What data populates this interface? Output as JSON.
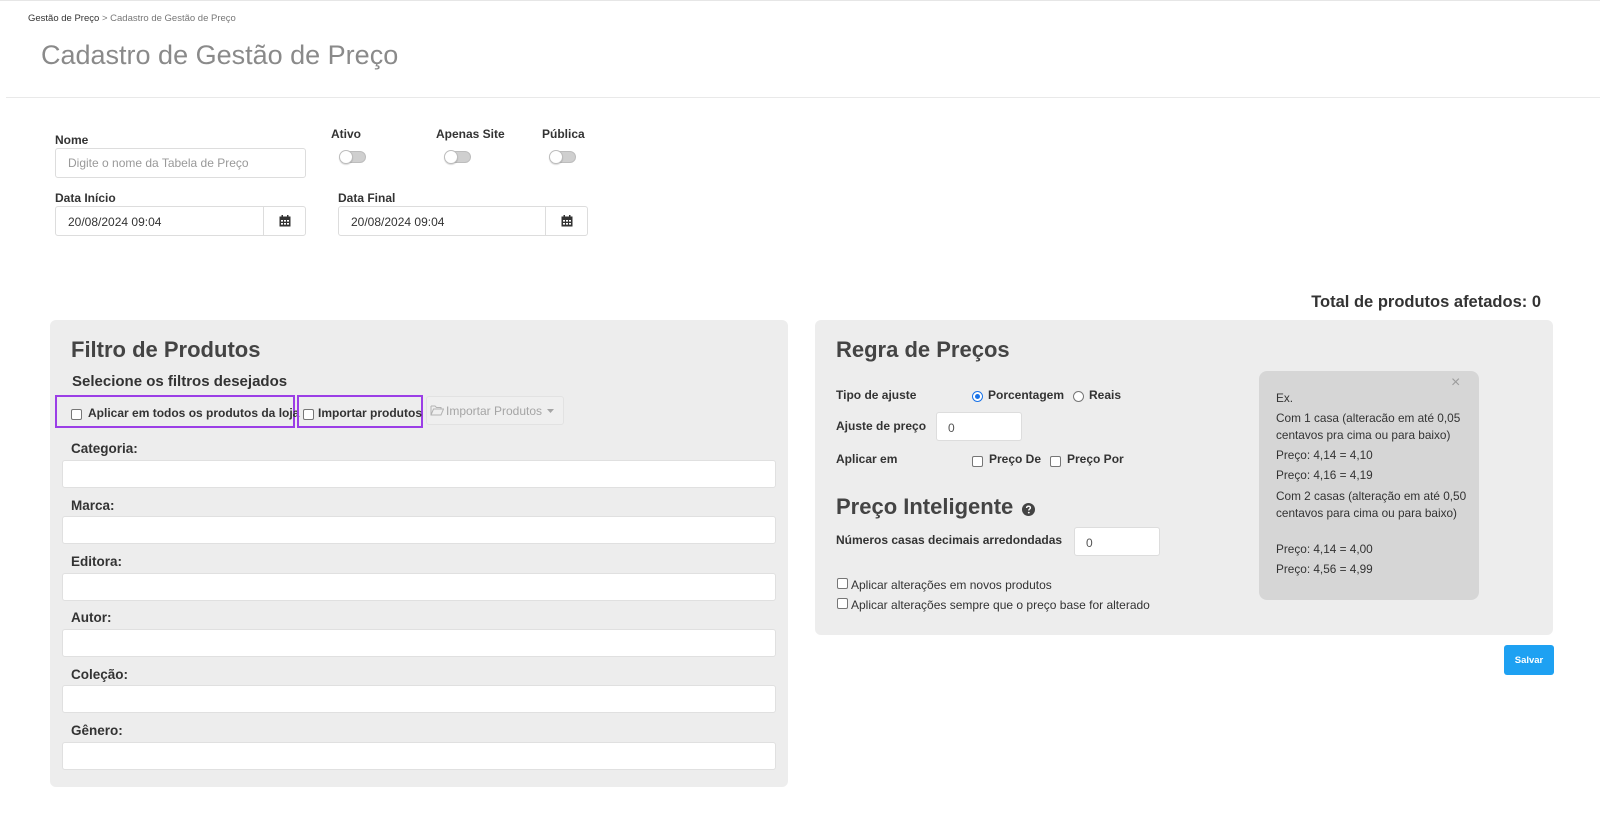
{
  "breadcrumb": {
    "parent": "Gestão de Preço",
    "separator": ">",
    "current": "Cadastro de Gestão de Preço"
  },
  "page_title": "Cadastro de Gestão de Preço",
  "form": {
    "nome_label": "Nome",
    "nome_placeholder": "Digite o nome da Tabela de Preço",
    "nome_value": "",
    "ativo_label": "Ativo",
    "apenas_site_label": "Apenas Site",
    "publica_label": "Pública",
    "toggles": {
      "ativo": false,
      "apenas_site": false,
      "publica": false
    },
    "data_inicio_label": "Data Início",
    "data_inicio_value": "20/08/2024 09:04",
    "data_final_label": "Data Final",
    "data_final_value": "20/08/2024 09:04"
  },
  "total_afetados": "Total de produtos afetados: 0",
  "filtro": {
    "title": "Filtro de Produtos",
    "subtitle": "Selecione os filtros desejados",
    "aplicar_todos_label": "Aplicar em todos os produtos da loja",
    "importar_label": "Importar produtos",
    "importar_button_label": "Importar Produtos",
    "fields": [
      {
        "label": "Categoria:",
        "value": ""
      },
      {
        "label": "Marca:",
        "value": ""
      },
      {
        "label": "Editora:",
        "value": ""
      },
      {
        "label": "Autor:",
        "value": ""
      },
      {
        "label": "Coleção:",
        "value": ""
      },
      {
        "label": "Gênero:",
        "value": ""
      }
    ]
  },
  "regra": {
    "title": "Regra de Preços",
    "tipo_label": "Tipo de ajuste",
    "tipo_options": [
      "Porcentagem",
      "Reais"
    ],
    "tipo_selected": "Porcentagem",
    "ajuste_label": "Ajuste de preço",
    "ajuste_value": "0",
    "aplicar_em_label": "Aplicar em",
    "aplicar_em_options": [
      "Preço De",
      "Preço Por"
    ],
    "preco_inteligente_title": "Preço Inteligente",
    "casas_label": "Números casas decimais arredondadas",
    "casas_value": "0",
    "novos_produtos_label": "Aplicar alterações em novos produtos",
    "preco_base_label": "Aplicar alterações sempre que o preço base for alterado"
  },
  "info": {
    "close": "×",
    "lines": [
      "Ex.",
      "Com 1 casa (alteracão em até 0,05 centavos pra cima ou para baixo)",
      "Preço: 4,14 = 4,10",
      "Preço: 4,16 = 4,19",
      "Com 2 casas (alteração em até 0,50 centavos para cima ou para baixo)",
      "Preço: 4,14 = 4,00",
      "Preço: 4,56 = 4,99"
    ]
  },
  "save_label": "Salvar",
  "colors": {
    "accent_blue": "#1ea1f2",
    "highlight_purple": "#9b3ee6",
    "panel_bg": "#ededed",
    "info_bg": "#d6d6d6"
  },
  "icons": [
    "calendar-icon",
    "folder-open-icon",
    "caret-down-icon",
    "question-circle-icon",
    "close-icon"
  ]
}
